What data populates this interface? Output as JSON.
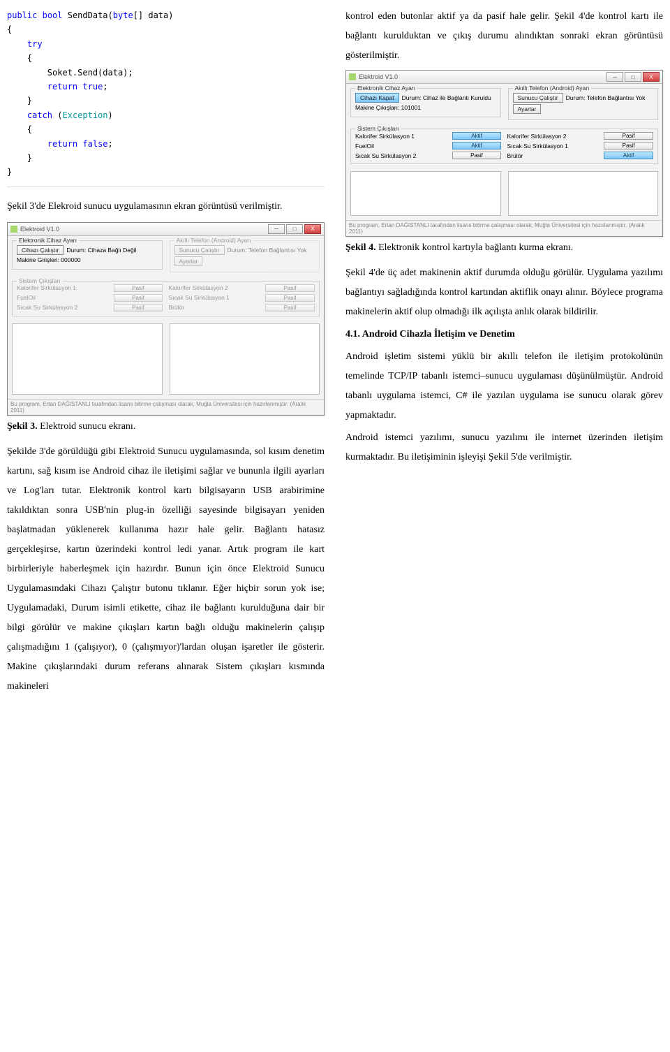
{
  "code": {
    "l1a": "public",
    "l1b": "bool",
    "l1c": "SendData(",
    "l1d": "byte",
    "l1e": "[] data)",
    "l2": "{",
    "l3": "try",
    "l4": "{",
    "l5a": "Soket.Send(data);",
    "l6": "return",
    "l6b": "true",
    "l6c": ";",
    "l7": "}",
    "l8": "catch",
    "l8b": "(",
    "l8c": "Exception",
    "l8d": ")",
    "l9": "{",
    "l10": "return",
    "l10b": "false",
    "l10c": ";",
    "l11": "}",
    "l12": "}"
  },
  "topRightPara": "kontrol eden butonlar aktif ya da pasif hale gelir. Şekil 4'de kontrol kartı ile bağlantı kurulduktan ve çıkış durumu alındıktan sonraki ekran görüntüsü gösterilmiştir.",
  "leftIntro": "Şekil 3'de Elekroid sunucu uygulamasının ekran görüntüsü verilmiştir.",
  "fig3": {
    "title": "Elektroid V1.0",
    "leftGroup": "Elektronik Cihaz Ayarı",
    "rightGroup": "Akıllı Telefon (Android) Ayarı",
    "btnLeft": "Cihazı Çalıştır",
    "statusLeftLabel": "Durum: Cihaza Bağlı Değil",
    "statusLeft2": "Makine Girişleri: 000000",
    "btnRight": "Sunucu Çalıştır",
    "statusRight": "Durum: Telefon Bağlantısı Yok",
    "btnSettings": "Ayarlar",
    "outputsTitle": "Sistem Çıkışları",
    "outputs": [
      [
        "Kalorifer Sirkülasyon 1",
        "Pasif"
      ],
      [
        "Kalorifer Sirkülasyon 2",
        "Pasif"
      ],
      [
        "FuelOil",
        "Pasif"
      ],
      [
        "Sıcak Su Sirkülasyon 1",
        "Pasif"
      ],
      [
        "Sıcak Su Sirkülasyon 2",
        "Pasif"
      ],
      [
        "Brülör",
        "Pasif"
      ]
    ],
    "footnote": "Bu program, Ertan DAĞISTANLI tarafından lisans bitirme çalışması olarak, Muğla Üniversitesi için hazırlanmıştır. (Aralık 2011)"
  },
  "fig3Caption": "Elektroid sunucu ekranı.",
  "fig3CaptionPrefix": "Şekil 3.",
  "bodyLeft": "Şekilde 3'de görüldüğü gibi Elektroid Sunucu uygulamasında, sol kısım denetim kartını, sağ kısım ise Android cihaz ile iletişimi sağlar ve bununla ilgili ayarları ve Log'ları tutar. Elektronik kontrol kartı bilgisayarın USB arabirimine takıldıktan sonra USB'nin plug-in özelliği sayesinde bilgisayarı yeniden başlatmadan yüklenerek kullanıma hazır hale gelir. Bağlantı hatasız gerçekleşirse, kartın üzerindeki kontrol ledi yanar. Artık program ile kart birbirleriyle haberleşmek için hazırdır. Bunun için önce Elektroid Sunucu Uygulamasındaki Cihazı Çalıştır butonu tıklanır. Eğer hiçbir sorun yok ise; Uygulamadaki, Durum isimli etikette, cihaz ile bağlantı kurulduğuna dair bir bilgi görülür ve makine çıkışları kartın bağlı olduğu makinelerin çalışıp çalışmadığını 1 (çalışıyor), 0 (çalışmıyor)'lardan oluşan işaretler ile gösterir. Makine çıkışlarındaki durum referans alınarak Sistem çıkışları kısmında makineleri",
  "fig4": {
    "title": "Elektroid V1.0",
    "leftGroup": "Elektronik Cihaz Ayarı",
    "rightGroup": "Akıllı Telefon (Android) Ayarı",
    "btnLeft": "Cihazı Kapat",
    "statusLeftLabel": "Durum: Cihaz ile Bağlantı Kuruldu",
    "statusLeft2": "Makine Çıkışları: 101001",
    "btnRight": "Sunucu Çalıştır",
    "statusRight": "Durum: Telefon Bağlantısı Yok",
    "btnSettings": "Ayarlar",
    "outputsTitle": "Sistem Çıkışları",
    "rows": [
      {
        "l1": "Kalorifer Sirkülasyon 1",
        "s1": "Aktif",
        "l2": "Kalorifer Sirkülasyon 2",
        "s2": "Pasif"
      },
      {
        "l1": "FuelOil",
        "s1": "Aktif",
        "l2": "Sıcak Su Sirkülasyon 1",
        "s2": "Pasif"
      },
      {
        "l1": "Sıcak Su Sirkülasyon 2",
        "s1": "Pasif",
        "l2": "Brülör",
        "s2": "Aktif"
      }
    ],
    "footnote": "Bu program, Ertan DAĞISTANLI tarafından lisans bitirme çalışması olarak, Muğla Üniversitesi için hazırlanmıştır. (Aralık 2011)"
  },
  "fig4CaptionPrefix": "Şekil 4.",
  "fig4Caption": "Elektronik kontrol kartıyla bağlantı kurma ekranı.",
  "bodyRight1": "Şekil 4'de üç adet makinenin aktif durumda olduğu görülür. Uygulama yazılımı bağlantıyı sağladığında kontrol kartından aktiflik onayı alınır. Böylece programa makinelerin aktif olup olmadığı ilk açılışta anlık olarak bildirilir.",
  "heading41": "4.1. Android Cihazla İletişim ve Denetim",
  "bodyRight2": "Android işletim sistemi yüklü bir akıllı telefon ile iletişim protokolünün temelinde TCP/IP tabanlı istemci–sunucu uygulaması düşünülmüştür. Android tabanlı uygulama istemci, C# ile yazılan uygulama ise sunucu olarak görev yapmaktadır.",
  "bodyRight3": "Android istemci yazılımı, sunucu yazılımı ile internet üzerinden iletişim kurmaktadır. Bu iletişiminin işleyişi Şekil 5'de verilmiştir."
}
